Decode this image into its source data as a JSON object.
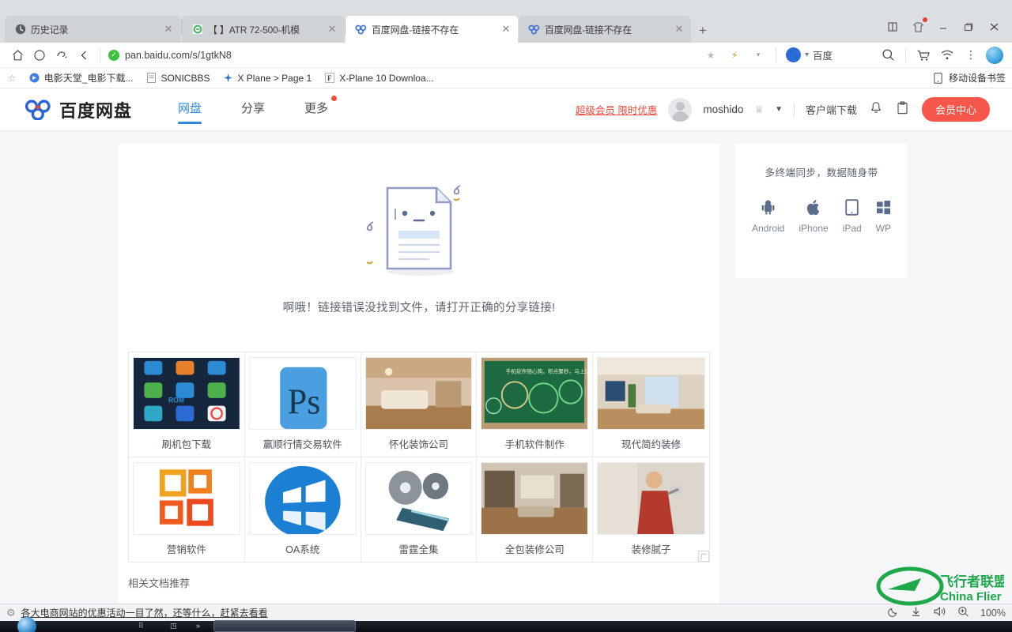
{
  "browser": {
    "tabs": [
      {
        "title": "历史记录",
        "icon": "history-icon",
        "active": false
      },
      {
        "title": "【             】ATR 72-500-机模",
        "icon": "green-circle-icon",
        "active": false
      },
      {
        "title": "百度网盘-链接不存在",
        "icon": "baidu-pan-icon",
        "active": true
      },
      {
        "title": "百度网盘-链接不存在",
        "icon": "baidu-pan-icon",
        "active": false
      }
    ],
    "new_tab_label": "+",
    "window_controls": [
      "split-view-icon",
      "skin-icon",
      "minimize-icon",
      "restore-icon",
      "close-icon"
    ],
    "nav": {
      "home_icon": "home-icon",
      "reload_icon": "reload-icon",
      "history_icon": "back-history-icon",
      "back_icon": "back-icon",
      "url": "pan.baidu.com/s/1gtkN8",
      "lock_glyph": "✓",
      "star_icon": "star-icon",
      "lightning_icon": "lightning-icon",
      "caret_icon": "caret-down-icon",
      "search_engine": "百度",
      "search_icon": "search-icon",
      "cart_icon": "cart-icon",
      "wifi_icon": "wifi-icon",
      "menu_icon": "more-menu-icon"
    },
    "bookmarks": {
      "star_icon": "star-outline-icon",
      "items": [
        {
          "label": "电影天堂_电影下载...",
          "icon": "movie-site-icon"
        },
        {
          "label": "SONICBBS",
          "icon": "page-icon"
        },
        {
          "label": "X Plane > Page 1",
          "icon": "xplane-icon"
        },
        {
          "label": "X-Plane 10 Downloa...",
          "icon": "f-icon"
        }
      ],
      "mobile_label": "移动设备书签",
      "mobile_icon": "mobile-device-icon"
    }
  },
  "site": {
    "logo_text": "百度网盘",
    "nav": [
      {
        "label": "网盘",
        "active": true,
        "dot": false
      },
      {
        "label": "分享",
        "active": false,
        "dot": false
      },
      {
        "label": "更多",
        "active": false,
        "dot": true
      }
    ],
    "promo_label": "超级会员 限时优惠",
    "username": "moshido",
    "crown_icon": "crown-icon",
    "chevron_icon": "chevron-down-icon",
    "client_download": "客户端下载",
    "bell_icon": "bell-icon",
    "clipboard_icon": "clipboard-icon",
    "vip_button": "会员中心",
    "accent_color": "#2b8ae0",
    "brand_red": "#f7564a"
  },
  "main": {
    "error_message": "啊哦！链接错误没找到文件，请打开正确的分享链接!",
    "doc_illustration": "sad-document-icon",
    "related_title": "相关文档推荐",
    "ads": [
      {
        "label": "刷机包下载",
        "thumb": "phone-app-grid"
      },
      {
        "label": "赢顺行情交易软件",
        "thumb": "photoshop-logo"
      },
      {
        "label": "怀化装饰公司",
        "thumb": "living-room-photo"
      },
      {
        "label": "手机软件制作",
        "thumb": "green-chalkboard"
      },
      {
        "label": "现代简约装修",
        "thumb": "modern-room-photo"
      },
      {
        "label": "营销软件",
        "thumb": "office-logo"
      },
      {
        "label": "OA系统",
        "thumb": "windows-logo"
      },
      {
        "label": "雷霆全集",
        "thumb": "film-reel"
      },
      {
        "label": "全包装修公司",
        "thumb": "interior-photo"
      },
      {
        "label": "装修腻子",
        "thumb": "worker-photo"
      }
    ],
    "ad_mark": "广"
  },
  "sidebar": {
    "title": "多终端同步，数据随身带",
    "platforms": [
      {
        "label": "Android",
        "icon": "android-icon"
      },
      {
        "label": "iPhone",
        "icon": "apple-icon"
      },
      {
        "label": "iPad",
        "icon": "ipad-icon"
      },
      {
        "label": "WP",
        "icon": "windows-phone-icon"
      }
    ]
  },
  "statusbar": {
    "gear_icon": "gear-icon",
    "message": "各大电商网站的优惠活动一目了然，还等什么，赶紧去看看",
    "moon_icon": "night-mode-icon",
    "download_icon": "download-icon",
    "sound_icon": "sound-icon",
    "zoom_icon": "zoom-icon",
    "zoom_level": "100%"
  },
  "watermark": {
    "cn": "飞行者联盟",
    "en": "China Flier"
  }
}
